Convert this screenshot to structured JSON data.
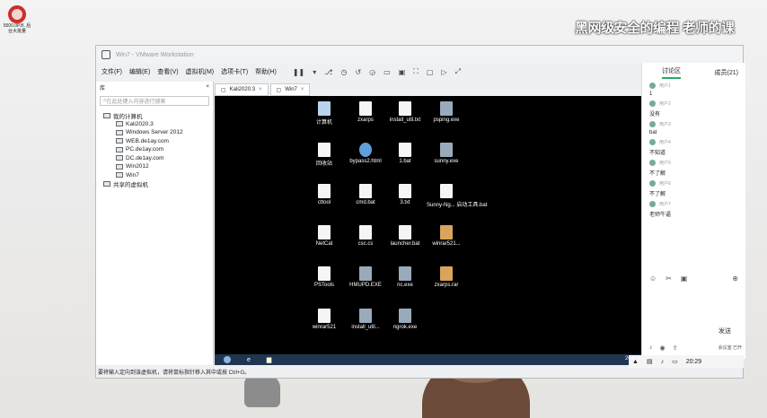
{
  "desktop": {
    "icon_label": "5500.0P.B. 后台大批量",
    "watermark": "黑网级安全的编程 老师的课"
  },
  "window": {
    "title": "Win7 - VMware Workstation",
    "menu": [
      "文件(F)",
      "编辑(E)",
      "查看(V)",
      "虚拟机(M)",
      "选项卡(T)",
      "帮助(H)"
    ],
    "toolbar_icons": [
      "pause",
      "dropdown",
      "send-keys",
      "snapshot",
      "revert",
      "manage",
      "fit",
      "unity",
      "fullscreen",
      "console",
      "view",
      "autofit"
    ]
  },
  "sidebar": {
    "header": "库",
    "search_placeholder": "在此处键入内容进行搜索",
    "tree": [
      {
        "label": "我的计算机",
        "level": 0
      },
      {
        "label": "Kali2020.3",
        "level": 1
      },
      {
        "label": "Windows Server 2012",
        "level": 1
      },
      {
        "label": "WEB.de1ay.com",
        "level": 1
      },
      {
        "label": "PC.de1ay.com",
        "level": 1
      },
      {
        "label": "DC.de1ay.com",
        "level": 1
      },
      {
        "label": "Win2012",
        "level": 1
      },
      {
        "label": "Win7",
        "level": 1
      },
      {
        "label": "共享的虚拟机",
        "level": 0
      }
    ]
  },
  "tabs": [
    {
      "label": "Kali2020.3"
    },
    {
      "label": "Win7"
    }
  ],
  "desktop_icons": [
    {
      "label": "计算机",
      "type": "pc"
    },
    {
      "label": "zxarps",
      "type": "doc"
    },
    {
      "label": "install_util.txt",
      "type": "doc"
    },
    {
      "label": "psping.exe",
      "type": "exe"
    },
    {
      "label": "回收站",
      "type": "doc"
    },
    {
      "label": "bypass2.html",
      "type": "ie"
    },
    {
      "label": "1.bat",
      "type": "doc"
    },
    {
      "label": "sunny.exe",
      "type": "exe"
    },
    {
      "label": "cttool",
      "type": "doc"
    },
    {
      "label": "cmd.bat",
      "type": "doc"
    },
    {
      "label": "3.txt",
      "type": "doc"
    },
    {
      "label": "Sunny-Ng... 启动工具.bat",
      "type": "doc"
    },
    {
      "label": "NetCat",
      "type": "doc"
    },
    {
      "label": "csc.cs",
      "type": "doc"
    },
    {
      "label": "launcher.bat",
      "type": "doc"
    },
    {
      "label": "winrar521...",
      "type": "rar"
    },
    {
      "label": "PSTools",
      "type": "doc"
    },
    {
      "label": "HMUPD.EXE",
      "type": "exe"
    },
    {
      "label": "nc.exe",
      "type": "exe"
    },
    {
      "label": "zxarps.rar",
      "type": "rar"
    },
    {
      "label": "winrar521",
      "type": "doc"
    },
    {
      "label": "install_util...",
      "type": "exe"
    },
    {
      "label": "ngrok.exe",
      "type": "exe"
    }
  ],
  "vm_taskbar": {
    "clock": "20:29"
  },
  "statusbar": {
    "text": "要将输入定向到该虚拟机，请将鼠标指针移入其中或按 Ctrl+G。"
  },
  "chat": {
    "tab_active": "讨论区",
    "tab_members": "成员(21)",
    "messages": [
      {
        "who": "用户1",
        "text": "1"
      },
      {
        "who": "用户2",
        "text": "没有"
      },
      {
        "who": "用户3",
        "text": "bat"
      },
      {
        "who": "用户4",
        "text": "不知道"
      },
      {
        "who": "用户5",
        "text": "不了解"
      },
      {
        "who": "用户6",
        "text": "不了解"
      },
      {
        "who": "用户7",
        "text": "老师牛逼"
      }
    ],
    "send_label": "发送",
    "footer_right": "会议室 已开"
  },
  "host_tray": {
    "clock": "20:29"
  }
}
